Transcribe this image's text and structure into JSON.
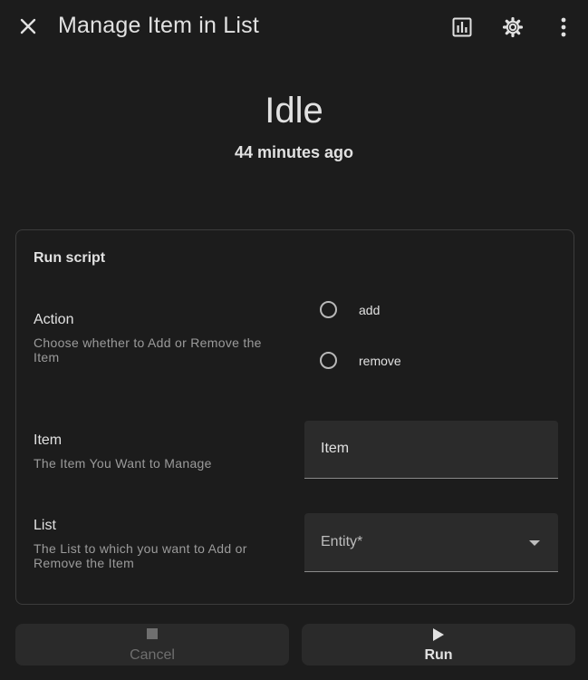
{
  "header": {
    "title": "Manage Item in List",
    "icons": [
      "close-icon",
      "history-chart-icon",
      "gear-icon",
      "more-vertical-icon"
    ]
  },
  "status": {
    "state": "Idle",
    "last_changed": "44 minutes ago"
  },
  "card": {
    "title": "Run script",
    "fields": {
      "action": {
        "name": "Action",
        "description": "Choose whether to Add or Remove the Item",
        "options": [
          "add",
          "remove"
        ]
      },
      "item": {
        "name": "Item",
        "description": "The Item You Want to Manage",
        "placeholder": "Item"
      },
      "list": {
        "name": "List",
        "description": "The List to which you want to Add or Remove the Item",
        "placeholder": "Entity*"
      }
    }
  },
  "actions": {
    "cancel_label": "Cancel",
    "run_label": "Run"
  },
  "colors": {
    "background": "#1c1c1c",
    "field_bg": "#2b2b2b",
    "button_bg": "#2a2a2a",
    "text": "#e1e1e1",
    "secondary_text": "#9b9b9b"
  }
}
